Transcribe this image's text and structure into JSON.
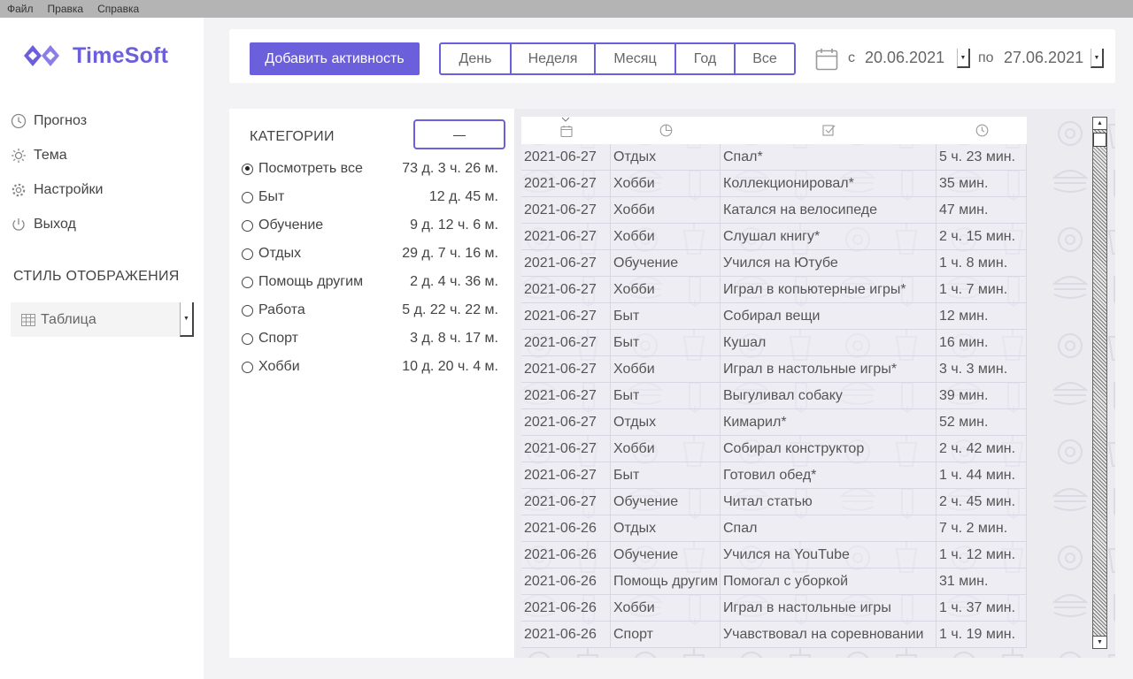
{
  "menu": {
    "items": [
      "Файл",
      "Правка",
      "Справка"
    ]
  },
  "brand": {
    "name": "TimeSoft",
    "color": "#6c5fdb"
  },
  "sidebar": {
    "items": [
      {
        "label": "Прогноз",
        "icon": "clock-icon"
      },
      {
        "label": "Тема",
        "icon": "sun-icon"
      },
      {
        "label": "Настройки",
        "icon": "gear-icon"
      },
      {
        "label": "Выход",
        "icon": "power-icon"
      }
    ],
    "style_title": "СТИЛЬ ОТОБРАЖЕНИЯ",
    "style_select": {
      "value": "Таблица",
      "icon": "table-icon"
    }
  },
  "toolbar": {
    "add_label": "Добавить активность",
    "periods": [
      "День",
      "Неделя",
      "Месяц",
      "Год",
      "Все"
    ],
    "from_label": "с",
    "from_date": "20.06.2021",
    "to_label": "по",
    "to_date": "27.06.2021"
  },
  "categories": {
    "title": "КАТЕГОРИИ",
    "collapse_label": "—",
    "selected_index": 0,
    "items": [
      {
        "name": "Посмотреть все",
        "duration": "73 д. 3 ч. 26 м."
      },
      {
        "name": "Быт",
        "duration": "12 д. 45 м."
      },
      {
        "name": "Обучение",
        "duration": "9 д. 12 ч. 6 м."
      },
      {
        "name": "Отдых",
        "duration": "29 д. 7 ч. 16 м."
      },
      {
        "name": "Помощь другим",
        "duration": "2 д. 4 ч. 36 м."
      },
      {
        "name": "Работа",
        "duration": "5 д. 22 ч. 22 м."
      },
      {
        "name": "Спорт",
        "duration": "3 д. 8 ч. 17 м."
      },
      {
        "name": "Хобби",
        "duration": "10 д. 20 ч. 4 м."
      }
    ]
  },
  "table": {
    "header_icons": [
      "calendar-icon",
      "pie-chart-icon",
      "checkbox-icon",
      "clock-icon"
    ],
    "rows": [
      [
        "2021-06-27",
        "Отдых",
        "Спал*",
        "5 ч. 23 мин."
      ],
      [
        "2021-06-27",
        "Хобби",
        "Коллекционировал*",
        "35 мин."
      ],
      [
        "2021-06-27",
        "Хобби",
        "Катался на велосипеде",
        "47 мин."
      ],
      [
        "2021-06-27",
        "Хобби",
        "Слушал книгу*",
        "2 ч. 15 мин."
      ],
      [
        "2021-06-27",
        "Обучение",
        "Учился на Ютубе",
        "1 ч. 8 мин."
      ],
      [
        "2021-06-27",
        "Хобби",
        "Играл в копьютерные игры*",
        "1 ч. 7 мин."
      ],
      [
        "2021-06-27",
        "Быт",
        "Собирал вещи",
        "12 мин."
      ],
      [
        "2021-06-27",
        "Быт",
        "Кушал",
        "16 мин."
      ],
      [
        "2021-06-27",
        "Хобби",
        "Играл в настольные игры*",
        "3 ч. 3 мин."
      ],
      [
        "2021-06-27",
        "Быт",
        "Выгуливал собаку",
        "39 мин."
      ],
      [
        "2021-06-27",
        "Отдых",
        "Кимарил*",
        "52 мин."
      ],
      [
        "2021-06-27",
        "Хобби",
        "Собирал конструктор",
        "2 ч. 42 мин."
      ],
      [
        "2021-06-27",
        "Быт",
        "Готовил обед*",
        "1 ч. 44 мин."
      ],
      [
        "2021-06-27",
        "Обучение",
        "Читал статью",
        "2 ч. 45 мин."
      ],
      [
        "2021-06-26",
        "Отдых",
        "Спал",
        "7 ч. 2 мин."
      ],
      [
        "2021-06-26",
        "Обучение",
        "Учился на YouTube",
        "1 ч. 12 мин."
      ],
      [
        "2021-06-26",
        "Помощь другим",
        "Помогал с уборкой",
        "31 мин."
      ],
      [
        "2021-06-26",
        "Хобби",
        "Играл в настольные игры",
        "1 ч. 37 мин."
      ],
      [
        "2021-06-26",
        "Спорт",
        "Учавствовал на соревновании",
        "1 ч. 19 мин."
      ]
    ]
  }
}
